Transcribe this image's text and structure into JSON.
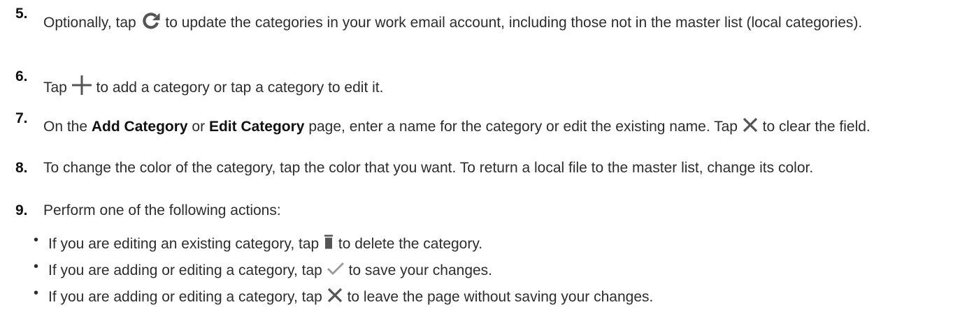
{
  "steps": [
    {
      "number": "5.",
      "parts": [
        "Optionally, tap",
        "to update the categories in your work email account, including those not in the master list (local categories)."
      ],
      "icon": "refresh-icon"
    },
    {
      "number": "6.",
      "parts": [
        "Tap",
        "to add a category or tap a category to edit it."
      ],
      "icon": "plus-icon"
    },
    {
      "number": "7.",
      "parts": [
        "On the",
        "Add Category",
        "or",
        "Edit Category",
        "page, enter a name for the category or edit the existing name. Tap",
        "to clear the field."
      ],
      "icon": "close-icon"
    },
    {
      "number": "8.",
      "text": "To change the color of the category, tap the color that you want. To return a local file to the master list, change its color."
    },
    {
      "number": "9.",
      "text": "Perform one of the following actions:"
    }
  ],
  "bullets": [
    {
      "bullet": "•",
      "parts": [
        "If you are editing an existing category, tap",
        "to delete the category."
      ],
      "icon": "trash-icon"
    },
    {
      "bullet": "•",
      "parts": [
        "If you are adding or editing a category, tap",
        "to save your changes."
      ],
      "icon": "checkmark-icon"
    },
    {
      "bullet": "•",
      "parts": [
        "If you are adding or editing a category, tap",
        "to leave the page without saving your changes."
      ],
      "icon": "close-icon"
    }
  ],
  "colors": {
    "text": "#2d2d2d",
    "number": "#111111",
    "icon": "#555555",
    "check_icon": "#9a9a9a"
  }
}
